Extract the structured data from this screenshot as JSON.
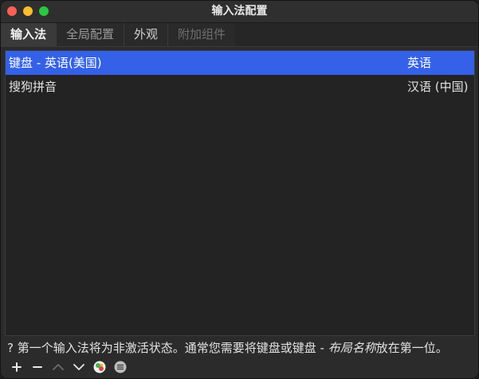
{
  "window": {
    "title": "输入法配置"
  },
  "tabs": [
    {
      "label": "输入法"
    },
    {
      "label": "全局配置"
    },
    {
      "label": "外观"
    },
    {
      "label": "附加组件"
    }
  ],
  "input_methods": [
    {
      "name": "键盘 - 英语(美国)",
      "language": "英语",
      "selected": true
    },
    {
      "name": "搜狗拼音",
      "language": "汉语 (中国)",
      "selected": false
    }
  ],
  "hint": {
    "prefix": "? 第一个输入法将为非激活状态。通常您需要将键盘或键盘 - ",
    "emphasis": "布局名称",
    "suffix": "放在第一位。"
  },
  "toolbar": {
    "add_icon": "plus-icon",
    "remove_icon": "minus-icon",
    "up_icon": "chevron-up-icon",
    "down_icon": "chevron-down-icon",
    "configure_icon": "configure-icon",
    "settings_icon": "menu-icon"
  },
  "colors": {
    "selection": "#3461e8",
    "close": "#fe5f57",
    "minimize": "#febc2e",
    "maximize": "#28c840"
  }
}
